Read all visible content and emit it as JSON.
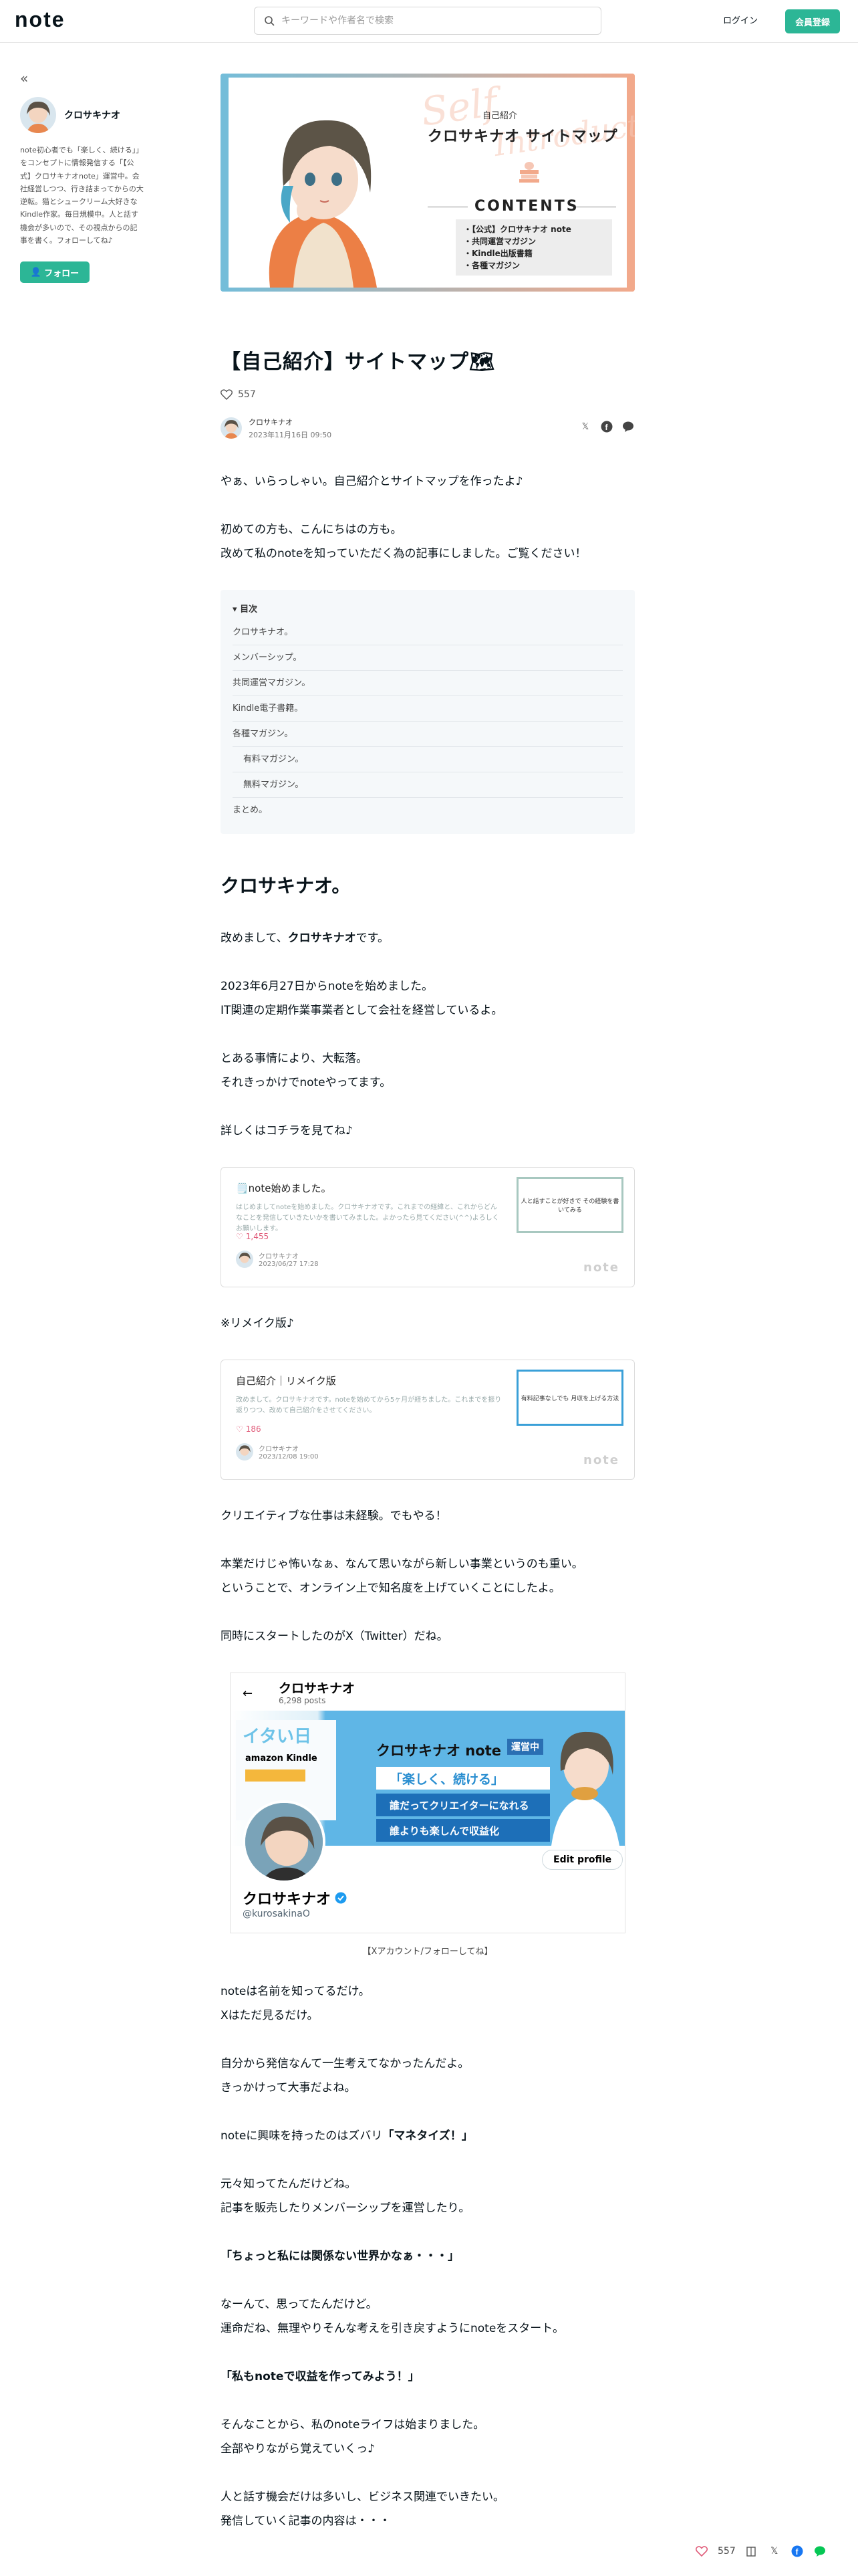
{
  "header": {
    "logo": "note",
    "search_placeholder": "キーワードや作者名で検索",
    "login_label": "ログイン",
    "signup_label": "会員登録"
  },
  "sidebar": {
    "collapse_icon": "«",
    "creator_name": "クロサキナオ",
    "bio": "note初心者でも「楽しく、続ける」」をコンセプトに情報発信する「【公式】クロサキナオnote」運営中。会社経営しつつ、行き詰まってからの大逆転。猫とシュークリーム大好きなKindle作家。毎日規模中。人と話す機会が多いので、その視点からの記事を書く。フォローしてね♪",
    "follow_label": "フォロー"
  },
  "hero": {
    "script_text_1": "Self",
    "script_text_2": "Introduction",
    "small_label": "自己紹介",
    "title": "クロサキナオ サイトマップ",
    "contents_label": "CONTENTS",
    "list": [
      "・【公式】クロサキナオ note",
      "・共同運営マガジン",
      "・Kindle出版書籍",
      "・各種マガジン"
    ]
  },
  "article": {
    "title": "【自己紹介】サイトマップ🗺",
    "like_count": "557",
    "author_name": "クロサキナオ",
    "published": "2023年11月16日 09:50",
    "intro_1": "やぁ、いらっしゃい。自己紹介とサイトマップを作ったよ♪",
    "intro_2": "初めての方も、こんにちはの方も。",
    "intro_3": "改めて私のnoteを知っていただく為の記事にしました。ご覧ください！"
  },
  "toc": {
    "heading": "目次",
    "items": [
      "クロサキナオ。",
      "メンバーシップ。",
      "共同運営マガジン。",
      "Kindle電子書籍。",
      "各種マガジン。",
      "有料マガジン。",
      "無料マガジン。",
      "まとめ。"
    ]
  },
  "section1": {
    "heading": "クロサキナオ。",
    "p1_a": "改めまして、",
    "p1_b": "クロサキナオ",
    "p1_c": "です。",
    "p2": "2023年6月27日からnoteを始めました。",
    "p3": "IT関連の定期作業事業者として会社を経営しているよ。",
    "p4": "とある事情により、大転落。",
    "p5": "それきっかけでnoteやってます。",
    "p6": "詳しくはコチラを見てね♪",
    "remake": "※リメイク版♪",
    "p7": "クリエイティブな仕事は未経験。でもやる！",
    "p8": "本業だけじゃ怖いなぁ、なんて思いながら新しい事業というのも重い。",
    "p9": "ということで、オンライン上で知名度を上げていくことにしたよ。",
    "p10": "同時にスタートしたのがX（Twitter）だね。",
    "caption": "【Xアカウント/フォローしてね】",
    "p11": "noteは名前を知ってるだけ。",
    "p12": "Xはただ見るだけ。",
    "p13": "自分から発信なんて一生考えてなかったんだよ。",
    "p14": "きっかけって大事だよね。",
    "p15_a": "noteに興味を持ったのはズバリ",
    "p15_b": "「マネタイズ！」",
    "p16": "元々知ってたんだけどね。",
    "p17": "記事を販売したりメンバーシップを運営したり。",
    "p18": "「ちょっと私には関係ない世界かなぁ・・・」",
    "p19": "なーんて、思ってたんだけど。",
    "p20": "運命だね、無理やりそんな考えを引き戻すようにnoteをスタート。",
    "p21": "「私もnoteで収益を作ってみよう！」",
    "p22": "そんなことから、私のnoteライフは始まりました。",
    "p23": "全部やりながら覚えていくっ♪",
    "p24": "人と話す機会だけは多いし、ビジネス関連でいきたい。",
    "p25": "発信していく記事の内容は・・・"
  },
  "embed1": {
    "title": "🗒️note始めました。",
    "desc": "はじめましてnoteを始めました。クロサキナオです。これまでの経緯と、これからどんなことを発信していきたいかを書いてみました。よかったら見てください(^^)よろしくお願いします。",
    "likes": "1,455",
    "author": "クロサキナオ",
    "date": "2023/06/27 17:28",
    "thumb": "人と話すことが好きで その経験を書いてみる",
    "logo": "note"
  },
  "embed2": {
    "title": "自己紹介｜リメイク版",
    "desc": "改めまして。クロサキナオです。noteを始めてから5ヶ月が経ちました。これまでを振り返りつつ、改めて自己紹介をさせてください。",
    "likes": "186",
    "author": "クロサキナオ",
    "date": "2023/12/08 19:00",
    "thumb": "有料記事なしでも 月収を上げる方法",
    "logo": "note"
  },
  "twitter": {
    "name": "クロサキナオ",
    "posts": "6,298 posts",
    "banner_left_1": "イタい日",
    "banner_left_2": "amazon Kindle",
    "banner_title": "クロサキナオ note",
    "banner_badge": "運営中",
    "banner_bar_1": "「楽しく、続ける」",
    "banner_bar_2": "誰だってクリエイターになれる",
    "banner_bar_3": "誰よりも楽しんで収益化",
    "edit_label": "Edit profile",
    "handle": "@kurosakinaO"
  },
  "floatbar": {
    "like_count": "557"
  },
  "colors": {
    "accent": "#2cb696",
    "hero_blue": "#74bdd9",
    "hero_peach": "#f2a98b",
    "like": "#e05b79"
  }
}
